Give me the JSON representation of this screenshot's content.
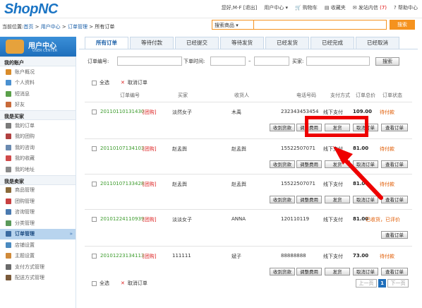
{
  "header": {
    "logo_main": "Shop",
    "logo_accent": "NC",
    "greeting": "您好,M-F [退出]",
    "user_center": "用户中心",
    "cart": "购物车",
    "favorites": "收藏夹",
    "messages": "发站内信",
    "msg_count": "(7)",
    "help": "帮助中心"
  },
  "breadcrumb": {
    "prefix": "当前位置:",
    "home": "首页",
    "sep1": " > ",
    "user_center": "用户中心",
    "sep2": " > ",
    "order_manage": "订单管理",
    "sep3": " > ",
    "current": "所有订单"
  },
  "search": {
    "category": "搜索商品",
    "button": "搜索"
  },
  "sidebar": {
    "title": "用户中心",
    "subtitle": "USER CENTER",
    "groups": [
      {
        "label": "我的账户",
        "items": [
          {
            "label": "账户概况",
            "color": "#d98c2b"
          },
          {
            "label": "个人资料",
            "color": "#4a90d0"
          },
          {
            "label": "短消息",
            "color": "#5aa04a"
          },
          {
            "label": "好友",
            "color": "#c86a3a"
          }
        ]
      },
      {
        "label": "我是买家",
        "items": [
          {
            "label": "我的订单",
            "color": "#7a7a7a"
          },
          {
            "label": "我的团购",
            "color": "#b04040"
          },
          {
            "label": "我的咨询",
            "color": "#6a8ab0"
          },
          {
            "label": "我的收藏",
            "color": "#d04a4a"
          },
          {
            "label": "我的地址",
            "color": "#8a8a8a"
          }
        ]
      },
      {
        "label": "我是卖家",
        "items": [
          {
            "label": "商品管理",
            "color": "#8a6a3a"
          },
          {
            "label": "团购管理",
            "color": "#c84040"
          },
          {
            "label": "咨询管理",
            "color": "#4a7ab0"
          },
          {
            "label": "分类管理",
            "color": "#5a9a5a"
          },
          {
            "label": "订单管理",
            "color": "#3a6aa0",
            "active": true
          },
          {
            "label": "店铺设置",
            "color": "#4a8ac0"
          },
          {
            "label": "主题设置",
            "color": "#d08a3a"
          },
          {
            "label": "支付方式管理",
            "color": "#6a6a6a"
          },
          {
            "label": "配送方式管理",
            "color": "#7a5a3a"
          }
        ]
      }
    ],
    "active_arrow": "»"
  },
  "tabs": [
    "所有订单",
    "等待付款",
    "已经提交",
    "等待发货",
    "已经发货",
    "已经完成",
    "已经取消"
  ],
  "filter": {
    "order_no_label": "订单编号:",
    "time_label": "下单时间:",
    "dash": "–",
    "buyer_label": "买家:",
    "search_button": "搜索"
  },
  "bulk": {
    "select_all": "全选",
    "cancel_orders": "取消订单"
  },
  "table": {
    "headers": [
      "订单编号",
      "买家",
      "收货人",
      "电话号码",
      "支付方式",
      "订单总价",
      "订单状态"
    ]
  },
  "orders": [
    {
      "no": "20110110131430",
      "tag": "[团购]",
      "buyer": "淡然女子",
      "receiver": "木禹",
      "phone": "232343453454",
      "pay": "线下支付",
      "total": "109.00",
      "status": "待付款",
      "buttons": [
        "收到货款",
        "调整费用",
        "发货",
        "取消订单",
        "查看订单"
      ]
    },
    {
      "no": "20110107134103",
      "tag": "[团购]",
      "buyer": "赵孟舆",
      "receiver": "赵孟舆",
      "phone": "15522507071",
      "pay": "线下支付",
      "total": "81.00",
      "status": "待付款",
      "buttons": [
        "收到货款",
        "调整费用",
        "发货",
        "取消订单",
        "查看订单"
      ]
    },
    {
      "no": "20110107133428",
      "tag": "[团购]",
      "buyer": "赵孟舆",
      "receiver": "赵孟舆",
      "phone": "15522507071",
      "pay": "线下支付",
      "total": "81.00",
      "status": "待付款",
      "buttons": [
        "收到货款",
        "调整费用",
        "发货",
        "取消订单",
        "查看订单"
      ]
    },
    {
      "no": "20101224110939",
      "tag": "[团购]",
      "buyer": "淡淡女子",
      "receiver": "ANNA",
      "phone": "120110119",
      "pay": "线下支付",
      "total": "81.00",
      "status": "已收货，已评价",
      "buttons": [
        "查看订单"
      ]
    },
    {
      "no": "20101223134113",
      "tag": "[团购]",
      "buyer": "111111",
      "receiver": "斌子",
      "phone": "88888888",
      "pay": "线下支付",
      "total": "73.00",
      "status": "待付款",
      "buttons": [
        "收到货款",
        "调整费用",
        "发货",
        "取消订单",
        "查看订单"
      ]
    }
  ],
  "pagination": {
    "prev": "上一页",
    "current": "1",
    "next": "下一页"
  },
  "colors": {
    "accent": "#1f6fbb",
    "search_orange": "#f5921e",
    "order_green": "#3a9a2a",
    "status_orange": "#e05a00",
    "highlight_red": "#e00000"
  }
}
